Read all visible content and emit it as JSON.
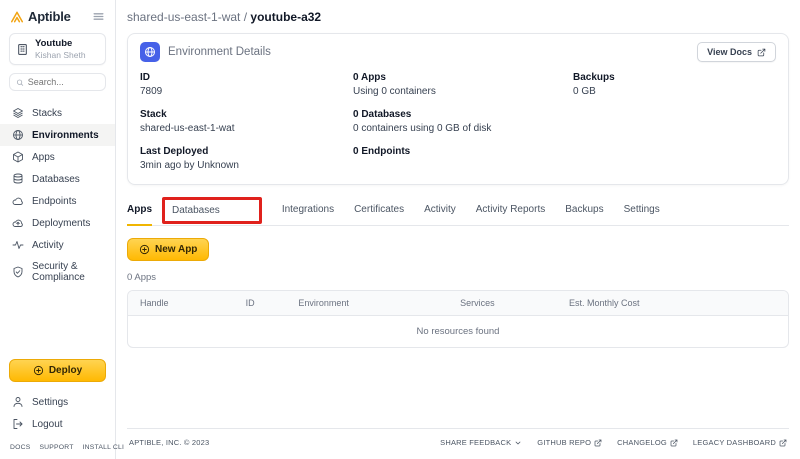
{
  "colors": {
    "brand_gold": "#FFB902",
    "accent_blue": "#4661E8",
    "annotation_red": "#E0211C",
    "active_tab_underline": "#F0B501"
  },
  "sidebar": {
    "logo_text": "Aptible",
    "org": {
      "name": "Youtube",
      "user": "Kishan Sheth"
    },
    "search_placeholder": "Search...",
    "nav": [
      {
        "label": "Stacks",
        "icon": "stacks-icon",
        "active": false
      },
      {
        "label": "Environments",
        "icon": "globe-icon",
        "active": true
      },
      {
        "label": "Apps",
        "icon": "cube-icon",
        "active": false
      },
      {
        "label": "Databases",
        "icon": "database-icon",
        "active": false
      },
      {
        "label": "Endpoints",
        "icon": "cloud-icon",
        "active": false
      },
      {
        "label": "Deployments",
        "icon": "cloud-upload-icon",
        "active": false
      },
      {
        "label": "Activity",
        "icon": "pulse-icon",
        "active": false
      },
      {
        "label": "Security & Compliance",
        "icon": "shield-check-icon",
        "active": false
      }
    ],
    "deploy_label": "Deploy",
    "settings_label": "Settings",
    "logout_label": "Logout",
    "bottom_links": [
      "DOCS",
      "SUPPORT",
      "INSTALL CLI"
    ]
  },
  "header": {
    "breadcrumb_parent": "shared-us-east-1-wat",
    "breadcrumb_separator": " / ",
    "breadcrumb_current": "youtube-a32"
  },
  "environment_details": {
    "title": "Environment Details",
    "view_docs_label": "View Docs",
    "columns": [
      [
        {
          "label": "ID",
          "value": "7809"
        },
        {
          "label": "Stack",
          "value": "shared-us-east-1-wat"
        },
        {
          "label": "Last Deployed",
          "value": "3min ago by Unknown"
        }
      ],
      [
        {
          "label": "0 Apps",
          "value": "Using 0 containers"
        },
        {
          "label": "0 Databases",
          "value": "0 containers using 0 GB of disk"
        },
        {
          "label": "0 Endpoints",
          "value": ""
        }
      ],
      [
        {
          "label": "Backups",
          "value": "0 GB"
        }
      ]
    ]
  },
  "tabs": {
    "active": "Apps",
    "annotated": "Databases",
    "items": [
      {
        "label": "Apps"
      },
      {
        "label": "Databases"
      },
      {
        "label": "Integrations"
      },
      {
        "label": "Certificates"
      },
      {
        "label": "Activity"
      },
      {
        "label": "Activity Reports"
      },
      {
        "label": "Backups"
      },
      {
        "label": "Settings"
      }
    ]
  },
  "apps_section": {
    "new_app_label": "New App",
    "count_label": "0 Apps",
    "table": {
      "headers": [
        "Handle",
        "ID",
        "Environment",
        "Services",
        "Est. Monthly Cost"
      ],
      "empty_message": "No resources found"
    }
  },
  "footer": {
    "copyright": "APTIBLE, INC. © 2023",
    "links": [
      "SHARE FEEDBACK",
      "GITHUB REPO",
      "CHANGELOG",
      "LEGACY DASHBOARD"
    ]
  }
}
